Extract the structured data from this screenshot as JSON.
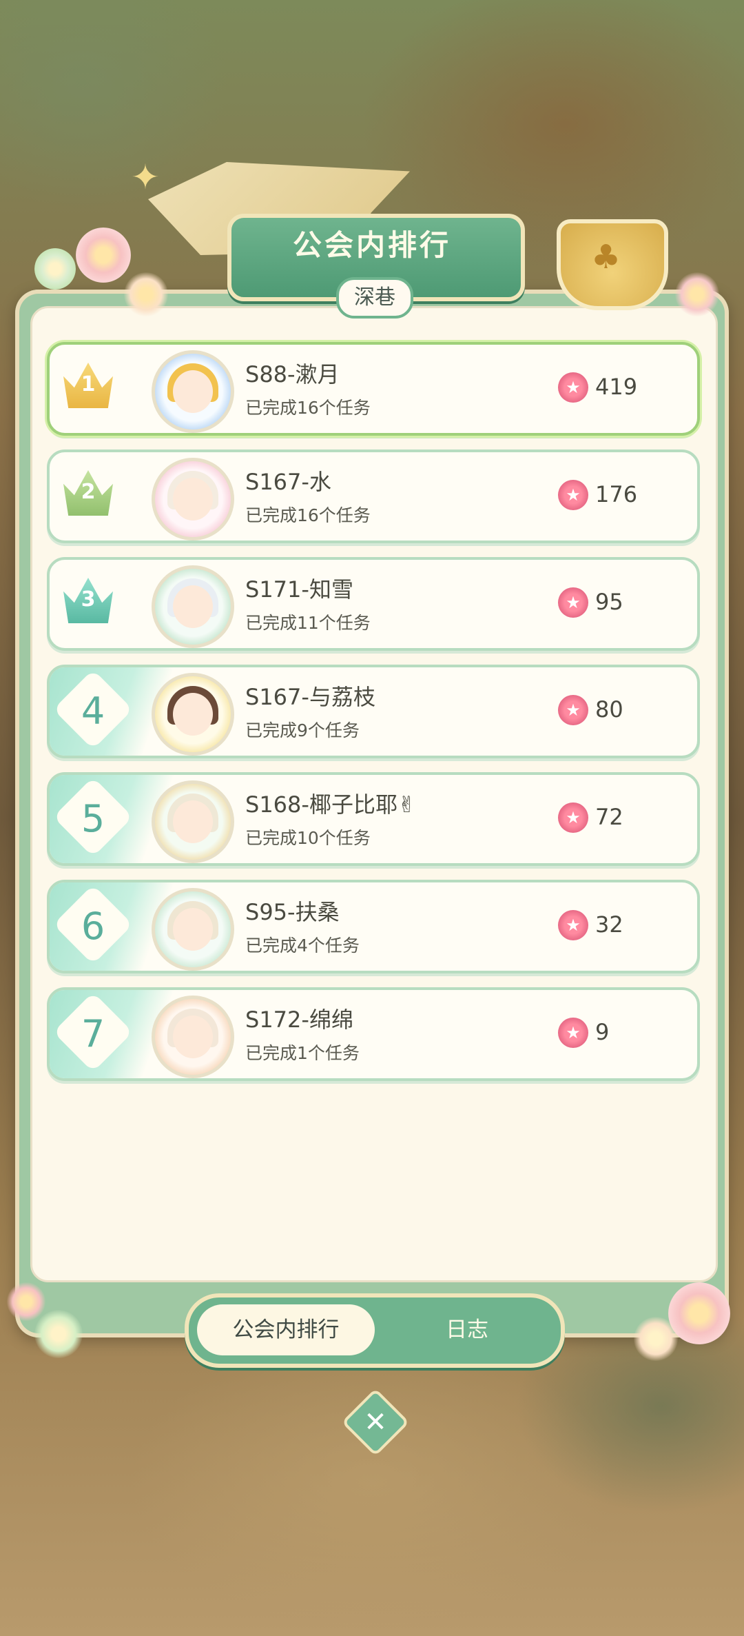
{
  "panel": {
    "title": "公会内排行",
    "guild_name": "深巷"
  },
  "rankings": [
    {
      "rank": "1",
      "name": "S88-漱月",
      "tasks": "已完成16个任务",
      "score": "419",
      "rank_style": "crown-gold"
    },
    {
      "rank": "2",
      "name": "S167-水",
      "tasks": "已完成16个任务",
      "score": "176",
      "rank_style": "crown-green"
    },
    {
      "rank": "3",
      "name": "S171-知雪",
      "tasks": "已完成11个任务",
      "score": "95",
      "rank_style": "crown-teal"
    },
    {
      "rank": "4",
      "name": "S167-与荔枝",
      "tasks": "已完成9个任务",
      "score": "80",
      "rank_style": "number"
    },
    {
      "rank": "5",
      "name": "S168-椰子比耶✌",
      "tasks": "已完成10个任务",
      "score": "72",
      "rank_style": "number"
    },
    {
      "rank": "6",
      "name": "S95-扶桑",
      "tasks": "已完成4个任务",
      "score": "32",
      "rank_style": "number"
    },
    {
      "rank": "7",
      "name": "S172-绵绵",
      "tasks": "已完成1个任务",
      "score": "9",
      "rank_style": "number"
    }
  ],
  "tabs": {
    "ranking_label": "公会内排行",
    "log_label": "日志"
  },
  "colors": {
    "accent_green": "#6fb48e",
    "panel_bg": "#fdf8ea",
    "crown_gold": "#f1c95c",
    "crown_green": "#a9cf84",
    "crown_teal": "#6ccbb4",
    "rank_number": "#5aae9b",
    "score_icon": "#e86a86"
  },
  "icons": {
    "score": "pink-flower-badge-icon",
    "close": "close-x-icon",
    "trophy": "golden-cup-icon"
  }
}
